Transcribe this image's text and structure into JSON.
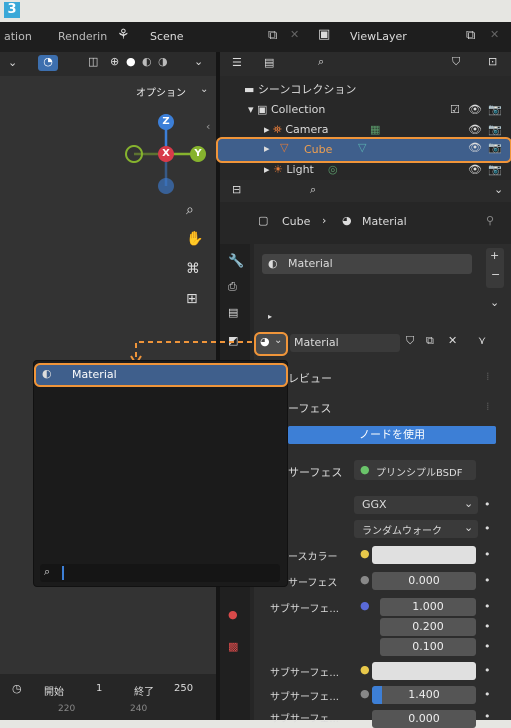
{
  "step_number": "3",
  "topbar": {
    "tab_fragment": "ation",
    "render_tab": "Renderin",
    "scene": "Scene",
    "viewlayer": "ViewLayer"
  },
  "viewport": {
    "options_label": "オプション",
    "gizmo": {
      "x": "X",
      "y": "Y",
      "z": "Z"
    }
  },
  "outliner": {
    "title": "シーンコレクション",
    "items": [
      {
        "label": "Collection"
      },
      {
        "label": "Camera"
      },
      {
        "label": "Cube"
      },
      {
        "label": "Light"
      }
    ]
  },
  "properties": {
    "breadcrumb_object": "Cube",
    "breadcrumb_material": "Material",
    "slot_label": "Material",
    "material_name": "Material",
    "sections": {
      "preview": "レビュー",
      "surface": "ーフェス"
    },
    "use_nodes_button": "ノードを使用",
    "surface_label": "サーフェス",
    "surface_value": "プリンシプルBSDF",
    "dropdowns": [
      "GGX",
      "ランダムウォーク"
    ],
    "params": [
      {
        "label": "ースカラー",
        "value": ""
      },
      {
        "label": "サーフェス",
        "value": "0.000"
      },
      {
        "label": "サブサーフェ...",
        "values": [
          "1.000",
          "0.200",
          "0.100"
        ]
      },
      {
        "label": "サブサーフェ...",
        "value": ""
      },
      {
        "label": "サブサーフェ...",
        "value": "1.400"
      },
      {
        "label": "サブサーフェ...",
        "value": "0.000"
      }
    ]
  },
  "popup": {
    "item": "Material"
  },
  "timeline": {
    "start_label": "開始",
    "start_value": "1",
    "end_label": "終了",
    "end_value": "250",
    "ruler": [
      "220",
      "240"
    ]
  },
  "colors": {
    "accent_orange": "#f0953a",
    "selection_blue": "#3f5f8c",
    "button_blue": "#3d7fd6",
    "axis_x": "#d83a4a",
    "axis_y": "#86b32e",
    "axis_z": "#3c7fd8"
  }
}
